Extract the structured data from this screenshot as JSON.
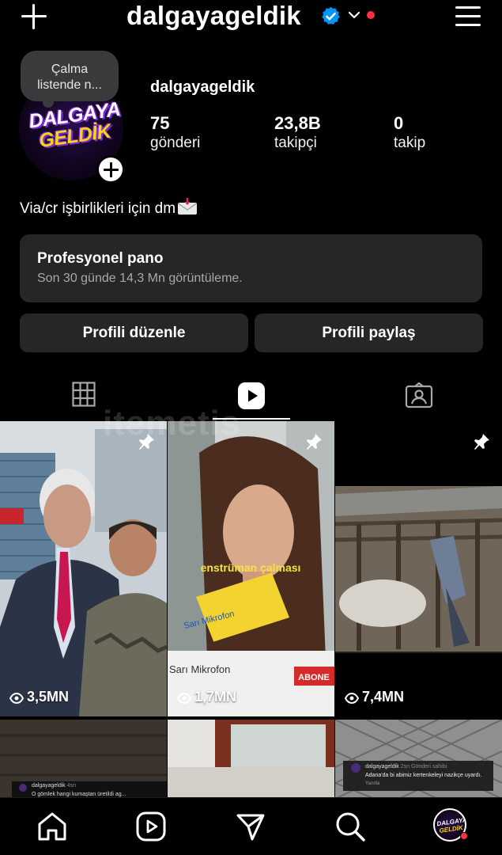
{
  "header": {
    "username": "dalgayageldik",
    "brand_color": "#0095f6",
    "alert_color": "#ff3040"
  },
  "note": {
    "line1": "Çalma",
    "line2": "listende n..."
  },
  "logo": {
    "line1": "DALGAYA",
    "line2": "GELDİK"
  },
  "profile": {
    "name": "dalgayageldik",
    "stats": [
      {
        "value": "75",
        "label": "gönderi"
      },
      {
        "value": "23,8B",
        "label": "takipçi"
      },
      {
        "value": "0",
        "label": "takip"
      }
    ],
    "bio": "Via/cr işbirlikleri için dm"
  },
  "dashboard": {
    "title": "Profesyonel pano",
    "subtitle": "Son 30 günde 14,3 Mn görüntüleme."
  },
  "buttons": {
    "edit": "Profili düzenle",
    "share": "Profili paylaş"
  },
  "tabs": [
    {
      "icon": "grid-icon"
    },
    {
      "icon": "reels-icon",
      "active": true
    },
    {
      "icon": "tagged-icon"
    }
  ],
  "watermark": "itemetis",
  "reels": [
    {
      "views": "3,5MN",
      "pinned": true
    },
    {
      "views": "1,7MN",
      "pinned": true,
      "caption": "enstrüman çalması",
      "mic_label": "Sarı Mikrofon",
      "badge": "ABONE"
    },
    {
      "views": "7,4MN",
      "pinned": true
    }
  ],
  "reels_row2": [
    {
      "user": "dalgayageldik",
      "time": "4sn",
      "text": "O gömlek hangi kumaştan üretildi ag..."
    },
    {},
    {
      "user": "dalgayageldik",
      "time": "2sn",
      "owner": "Gönderi sahibi",
      "text": "Adana'da bi abimiz kertenkeleyi nazikçe uyardı.",
      "reply": "Yanıtla"
    }
  ],
  "bottom_nav": [
    {
      "icon": "home-icon"
    },
    {
      "icon": "reels-nav-icon"
    },
    {
      "icon": "send-icon"
    },
    {
      "icon": "search-icon"
    },
    {
      "icon": "profile-avatar"
    }
  ]
}
